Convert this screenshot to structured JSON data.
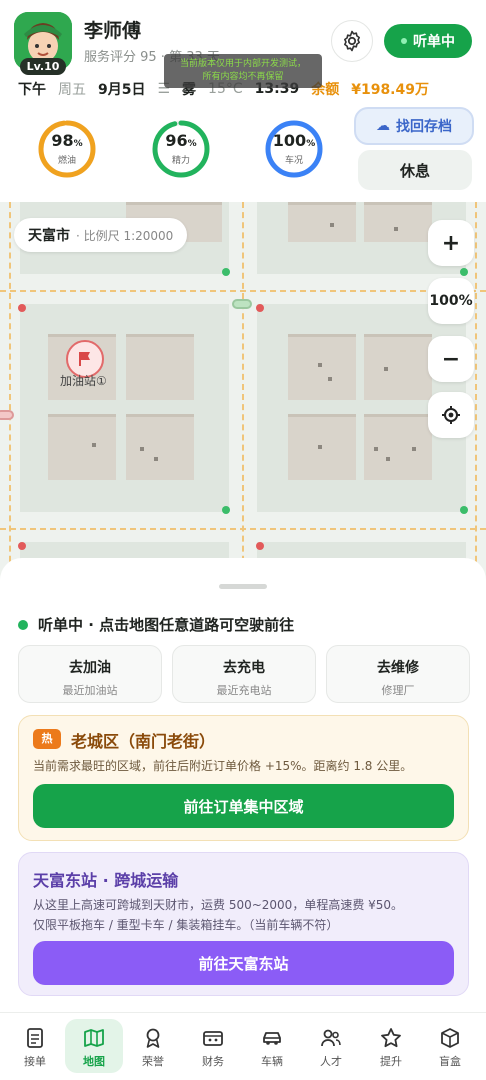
{
  "profile": {
    "name": "李师傅",
    "level": "Lv.10",
    "rating": "服务评分 95 · 第 33 天"
  },
  "notice": {
    "line1": "当前版本仅用于内部开发测试，",
    "line2": "所有内容均不再保留"
  },
  "header": {
    "status_label": "听单中"
  },
  "info": {
    "period": "下午",
    "weekday": "周五",
    "date": "9月5日",
    "weather": "雾",
    "temp": "15°C",
    "time": "13:39",
    "balance_label": "余额",
    "balance": "¥198.49万"
  },
  "gauges": [
    {
      "value": "98",
      "unit": "%",
      "label": "燃油",
      "pct": 0.98,
      "color": "#f0a21f"
    },
    {
      "value": "96",
      "unit": "%",
      "label": "精力",
      "pct": 0.96,
      "color": "#22b35d"
    },
    {
      "value": "100",
      "unit": "%",
      "label": "车况",
      "pct": 1.0,
      "color": "#3b82f6"
    }
  ],
  "actions": {
    "restore": "找回存档",
    "rest": "休息"
  },
  "map": {
    "city": "天富市",
    "scale": "· 比例尺 1:20000",
    "zoom": "100%",
    "zoom_in": "+",
    "zoom_out": "−",
    "gas_label": "加油站①"
  },
  "sheet": {
    "status": "听单中 · 点击地图任意道路可空驶前往",
    "quick": [
      {
        "title": "去加油",
        "sub": "最近加油站"
      },
      {
        "title": "去充电",
        "sub": "最近充电站"
      },
      {
        "title": "去维修",
        "sub": "修理厂"
      }
    ],
    "hot": {
      "tag": "热",
      "title": "老城区（南门老街）",
      "desc": "当前需求最旺的区域，前往后附近订单价格 +15%。距离约 1.8 公里。",
      "button": "前往订单集中区域"
    },
    "station": {
      "title": "天富东站 · 跨城运输",
      "desc1": "从这里上高速可跨城到天财市，运费 500~2000，单程高速费 ¥50。",
      "desc2": "仅限平板拖车 / 重型卡车 / 集装箱挂车。（当前车辆不符）",
      "button": "前往天富东站"
    }
  },
  "tabs": [
    {
      "label": "接单",
      "icon": "order-icon"
    },
    {
      "label": "地图",
      "icon": "map-icon"
    },
    {
      "label": "荣誉",
      "icon": "medal-icon"
    },
    {
      "label": "财务",
      "icon": "wallet-icon"
    },
    {
      "label": "车辆",
      "icon": "car-icon"
    },
    {
      "label": "人才",
      "icon": "people-icon"
    },
    {
      "label": "提升",
      "icon": "star-icon"
    },
    {
      "label": "盲盒",
      "icon": "box-icon"
    }
  ],
  "colors": {
    "primary": "#16a34a",
    "purple": "#8b5cf6",
    "orange": "#e8910c"
  }
}
